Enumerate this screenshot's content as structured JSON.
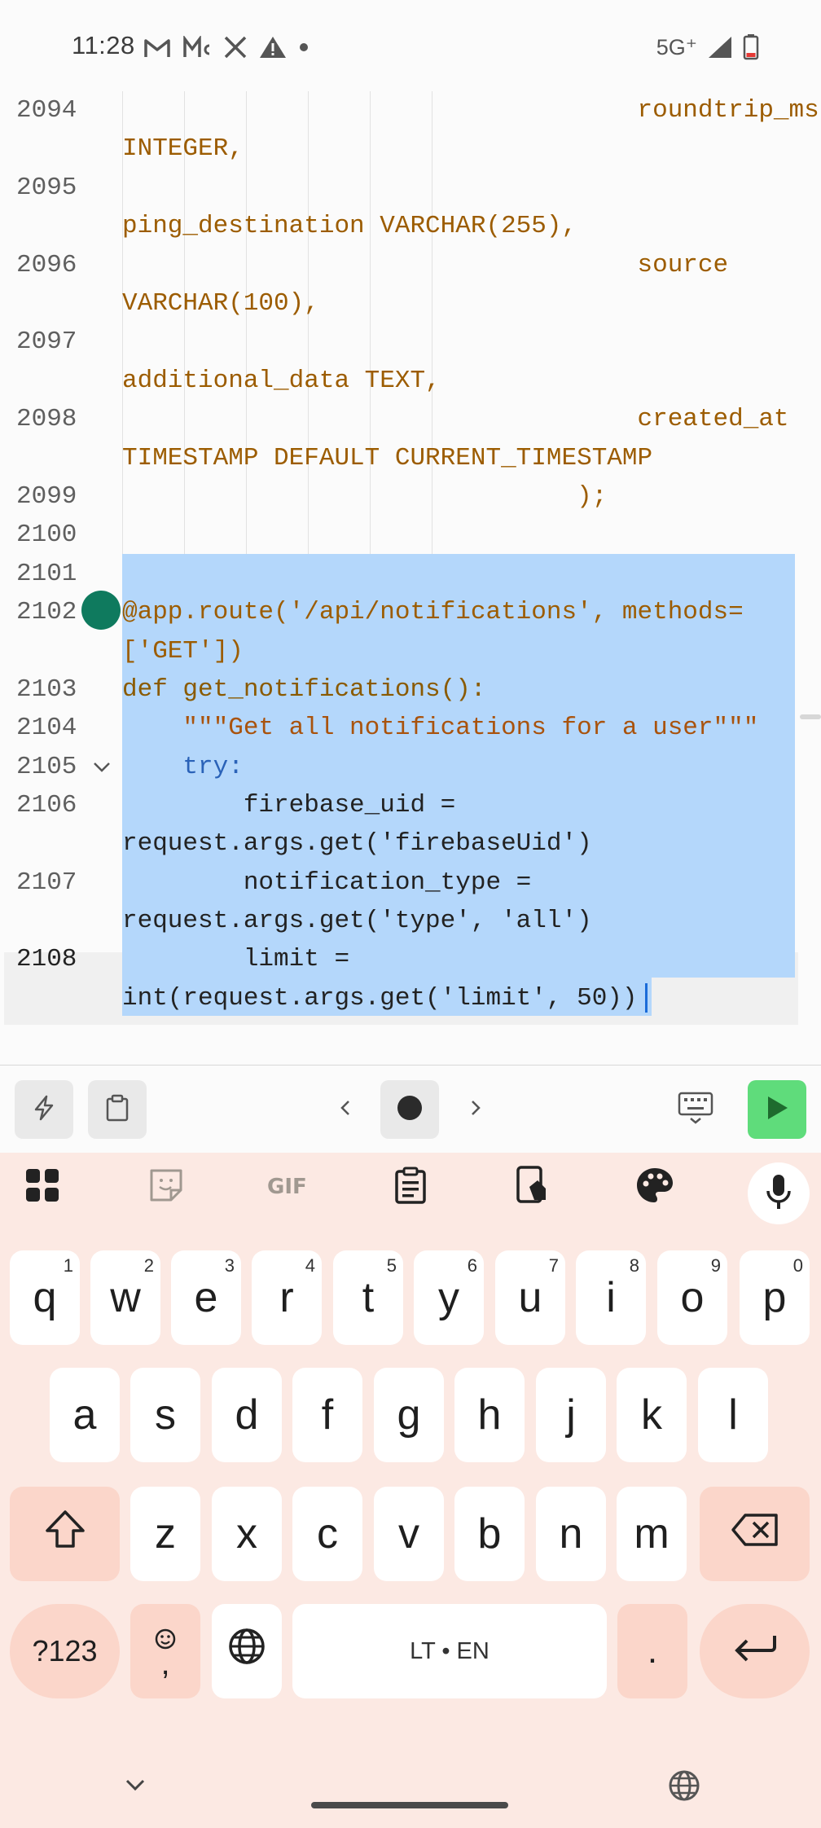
{
  "status_bar": {
    "time": "11:28",
    "left_icons": [
      "gmail-icon",
      "app-notification-icon",
      "x-icon",
      "warning-icon",
      "dot-icon"
    ],
    "network": "5G⁺",
    "right_icons": [
      "signal-icon",
      "battery-low-icon"
    ]
  },
  "editor": {
    "lines": [
      {
        "num": "2094",
        "text": "                                  roundtrip_ms"
      },
      {
        "num": "",
        "text": "INTEGER,"
      },
      {
        "num": "2095",
        "text": ""
      },
      {
        "num": "",
        "text": "ping_destination VARCHAR(255),"
      },
      {
        "num": "2096",
        "text": "                                  source"
      },
      {
        "num": "",
        "text": "VARCHAR(100),"
      },
      {
        "num": "2097",
        "text": ""
      },
      {
        "num": "",
        "text": "additional_data TEXT,"
      },
      {
        "num": "2098",
        "text": "                                  created_at"
      },
      {
        "num": "",
        "text": "TIMESTAMP DEFAULT CURRENT_TIMESTAMP"
      },
      {
        "num": "2099",
        "text": "                              );"
      },
      {
        "num": "2100",
        "text": ""
      },
      {
        "num": "2101",
        "text": ""
      },
      {
        "num": "2102",
        "text": "@app.route('/api/notifications', methods="
      },
      {
        "num": "",
        "text": "['GET'])"
      },
      {
        "num": "2103",
        "text": "def get_notifications():"
      },
      {
        "num": "2104",
        "text": "    \"\"\"Get all notifications for a user\"\"\""
      },
      {
        "num": "2105",
        "text": "    try:"
      },
      {
        "num": "2106",
        "text": "        firebase_uid ="
      },
      {
        "num": "",
        "text": "request.args.get('firebaseUid')"
      },
      {
        "num": "2107",
        "text": "        notification_type ="
      },
      {
        "num": "",
        "text": "request.args.get('type', 'all')"
      },
      {
        "num": "2108",
        "text": "        limit ="
      },
      {
        "num": "",
        "text": "int(request.args.get('limit', 50))"
      }
    ]
  },
  "toolbar": {
    "buttons": [
      "lightning-icon",
      "clipboard-icon",
      "chevron-left-icon",
      "record-icon",
      "chevron-right-icon",
      "keyboard-icon",
      "run-icon"
    ]
  },
  "keyboard": {
    "row1": [
      {
        "key": "q",
        "hint": "1"
      },
      {
        "key": "w",
        "hint": "2"
      },
      {
        "key": "e",
        "hint": "3"
      },
      {
        "key": "r",
        "hint": "4"
      },
      {
        "key": "t",
        "hint": "5"
      },
      {
        "key": "y",
        "hint": "6"
      },
      {
        "key": "u",
        "hint": "7"
      },
      {
        "key": "i",
        "hint": "8"
      },
      {
        "key": "o",
        "hint": "9"
      },
      {
        "key": "p",
        "hint": "0"
      }
    ],
    "row2": [
      "a",
      "s",
      "d",
      "f",
      "g",
      "h",
      "j",
      "k",
      "l"
    ],
    "row3": [
      "z",
      "x",
      "c",
      "v",
      "b",
      "n",
      "m"
    ],
    "symbols_label": "?123",
    "comma_label": ",",
    "space_label": "LT • EN",
    "period_label": ".",
    "accent_color": "#fbd6ca",
    "background_color": "#fce9e3"
  }
}
